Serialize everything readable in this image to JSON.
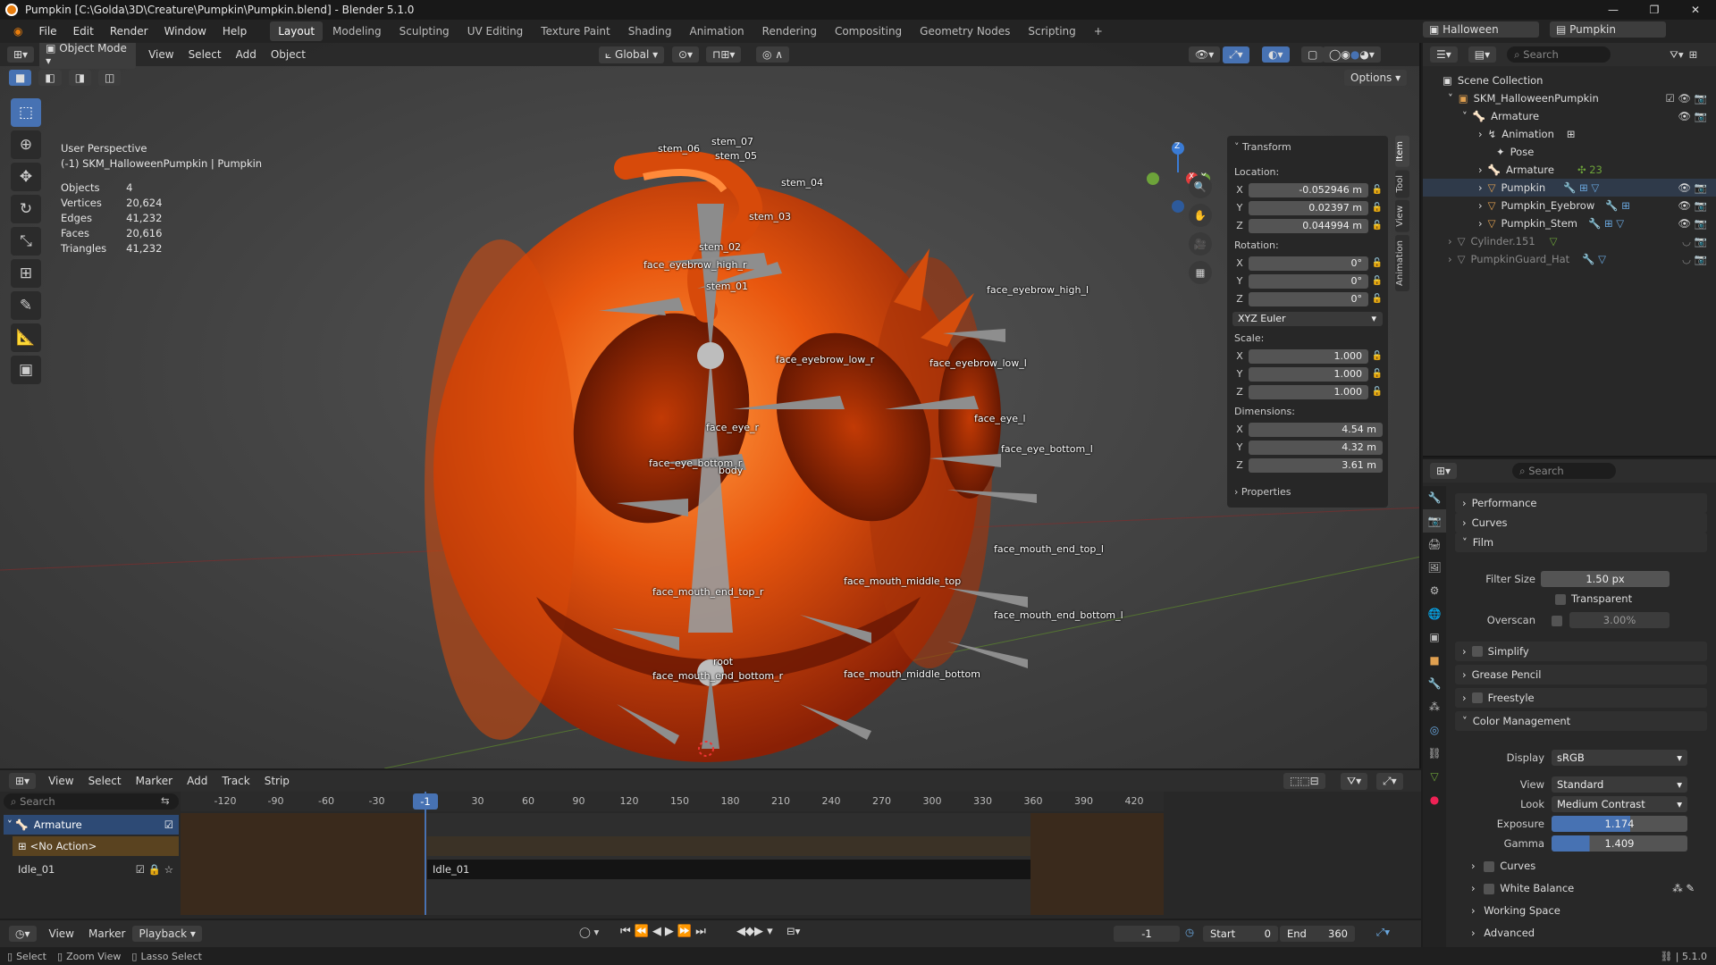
{
  "window": {
    "title": "Pumpkin [C:\\Golda\\3D\\Creature\\Pumpkin\\Pumpkin.blend] - Blender 5.1.0"
  },
  "menu": [
    "File",
    "Edit",
    "Render",
    "Window",
    "Help"
  ],
  "workspaces": [
    "Layout",
    "Modeling",
    "Sculpting",
    "UV Editing",
    "Texture Paint",
    "Shading",
    "Animation",
    "Rendering",
    "Compositing",
    "Geometry Nodes",
    "Scripting"
  ],
  "scene": {
    "name": "Halloween",
    "layer": "Pumpkin"
  },
  "viewport": {
    "mode": "Object Mode",
    "menus": [
      "View",
      "Select",
      "Add",
      "Object"
    ],
    "orientation": "Global",
    "options": "Options",
    "perspective": "User Perspective",
    "context": "(-1) SKM_HalloweenPumpkin | Pumpkin",
    "stats": [
      {
        "label": "Objects",
        "value": "4"
      },
      {
        "label": "Vertices",
        "value": "20,624"
      },
      {
        "label": "Edges",
        "value": "41,232"
      },
      {
        "label": "Faces",
        "value": "20,616"
      },
      {
        "label": "Triangles",
        "value": "41,232"
      }
    ],
    "bones": [
      "stem_07",
      "stem_06",
      "stem_05",
      "stem_04",
      "stem_03",
      "stem_02",
      "stem_01",
      "face_eyebrow_high_r",
      "face_eyebrow_high_l",
      "face_eyebrow_low_r",
      "face_eyebrow_low_l",
      "face_eye_r",
      "face_eye_l",
      "face_eye_bottom_r",
      "body",
      "face_eye_bottom_l",
      "face_mouth_end_top_l",
      "face_mouth_middle_top",
      "face_mouth_end_top_r",
      "face_mouth_end_bottom_l",
      "root",
      "face_mouth_end_bottom_r",
      "face_mouth_middle_bottom"
    ],
    "gizmo": {
      "z": "Z",
      "x": "X",
      "y": "Y"
    }
  },
  "npanel": {
    "title": "Transform",
    "location_label": "Location:",
    "loc": [
      "-0.052946 m",
      "0.02397 m",
      "0.044994 m"
    ],
    "rotation_label": "Rotation:",
    "rot": [
      "0°",
      "0°",
      "0°"
    ],
    "rot_mode": "XYZ Euler",
    "scale_label": "Scale:",
    "scale": [
      "1.000",
      "1.000",
      "1.000"
    ],
    "dim_label": "Dimensions:",
    "dim": [
      "4.54 m",
      "4.32 m",
      "3.61 m"
    ],
    "axes": [
      "X",
      "Y",
      "Z"
    ],
    "properties": "Properties",
    "tabs": [
      "Item",
      "Tool",
      "View",
      "Animation"
    ]
  },
  "outliner": {
    "search": "Search",
    "rows": [
      {
        "label": "Scene Collection",
        "indent": 0
      },
      {
        "label": "SKM_HalloweenPumpkin",
        "indent": 1
      },
      {
        "label": "Armature",
        "indent": 2
      },
      {
        "label": "Animation",
        "indent": 3
      },
      {
        "label": "Pose",
        "indent": 3
      },
      {
        "label": "Armature",
        "indent": 3
      },
      {
        "label": "Pumpkin",
        "indent": 3
      },
      {
        "label": "Pumpkin_Eyebrow",
        "indent": 3
      },
      {
        "label": "Pumpkin_Stem",
        "indent": 3
      },
      {
        "label": "Cylinder.151",
        "indent": 1
      },
      {
        "label": "PumpkinGuard_Hat",
        "indent": 1
      }
    ]
  },
  "properties": {
    "search": "Search",
    "performance": "Performance",
    "curves": "Curves",
    "film": "Film",
    "filter_size_label": "Filter Size",
    "filter_size": "1.50 px",
    "transparent": "Transparent",
    "overscan_label": "Overscan",
    "overscan": "3.00%",
    "simplify": "Simplify",
    "grease_pencil": "Grease Pencil",
    "freestyle": "Freestyle",
    "color_management": "Color Management",
    "display_label": "Display",
    "display": "sRGB",
    "view_label": "View",
    "view": "Standard",
    "look_label": "Look",
    "look": "Medium Contrast",
    "exposure_label": "Exposure",
    "exposure": "1.174",
    "gamma_label": "Gamma",
    "gamma": "1.409",
    "curves2": "Curves",
    "white_balance": "White Balance",
    "working_space": "Working Space",
    "advanced": "Advanced"
  },
  "timeline": {
    "menus": [
      "View",
      "Select",
      "Marker",
      "Add",
      "Track",
      "Strip"
    ],
    "search": "Search",
    "ticks": [
      "-120",
      "-90",
      "-60",
      "-30",
      "-1",
      "30",
      "60",
      "90",
      "120",
      "150",
      "180",
      "210",
      "240",
      "270",
      "300",
      "330",
      "360",
      "390",
      "420"
    ],
    "channel": "Armature",
    "action": "<No Action>",
    "track": "Idle_01",
    "strip": "Idle_01",
    "footer_menus": [
      "View",
      "Marker"
    ],
    "playback": "Playback",
    "current": "-1",
    "start_label": "Start",
    "start": "0",
    "end_label": "End",
    "end": "360"
  },
  "status": {
    "select": "Select",
    "zoom": "Zoom View",
    "lasso": "Lasso Select",
    "version": "5.1.0"
  },
  "colors": {
    "accent": "#4772b3",
    "pumpkin": "#e65a10",
    "bone": "#9a9a9a"
  }
}
